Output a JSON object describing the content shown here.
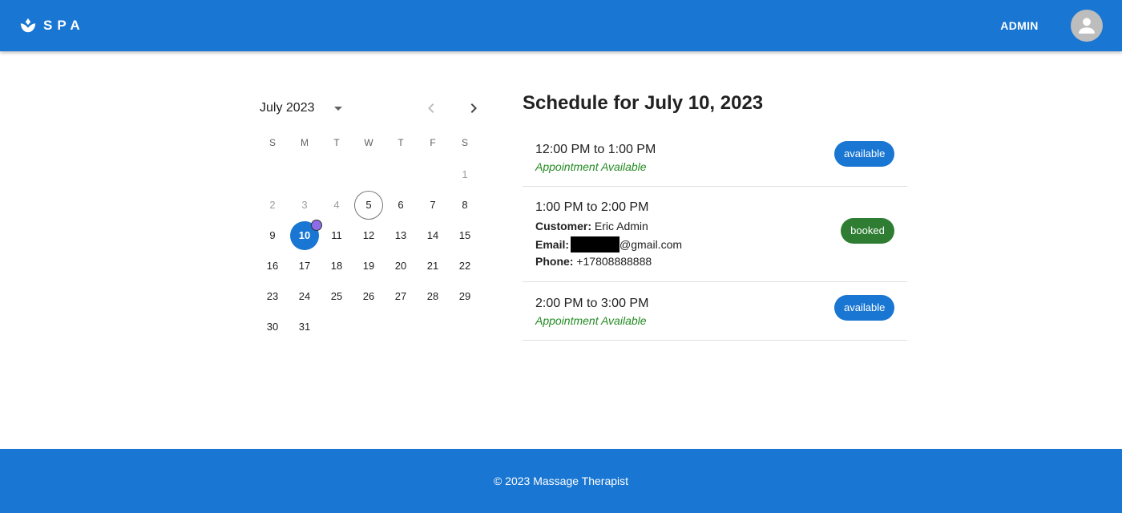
{
  "header": {
    "brand": "SPA",
    "admin_label": "ADMIN",
    "logo_icon": "lotus-icon",
    "avatar_icon": "person-icon"
  },
  "calendar": {
    "month_label": "July 2023",
    "weekdays": [
      "S",
      "M",
      "T",
      "W",
      "T",
      "F",
      "S"
    ],
    "days": [
      {
        "label": "1",
        "muted": true
      },
      {
        "label": "2",
        "muted": true
      },
      {
        "label": "3",
        "muted": true
      },
      {
        "label": "4",
        "muted": true
      },
      {
        "label": "5",
        "today": true
      },
      {
        "label": "6"
      },
      {
        "label": "7"
      },
      {
        "label": "8"
      },
      {
        "label": "9"
      },
      {
        "label": "10",
        "selected": true,
        "has_badge": true
      },
      {
        "label": "11"
      },
      {
        "label": "12"
      },
      {
        "label": "13"
      },
      {
        "label": "14"
      },
      {
        "label": "15"
      },
      {
        "label": "16"
      },
      {
        "label": "17"
      },
      {
        "label": "18"
      },
      {
        "label": "19"
      },
      {
        "label": "20"
      },
      {
        "label": "21"
      },
      {
        "label": "22"
      },
      {
        "label": "23"
      },
      {
        "label": "24"
      },
      {
        "label": "25"
      },
      {
        "label": "26"
      },
      {
        "label": "27"
      },
      {
        "label": "28"
      },
      {
        "label": "29"
      },
      {
        "label": "30"
      },
      {
        "label": "31"
      }
    ],
    "first_weekday_index": 6,
    "colors": {
      "selected": "#1976d2",
      "badge": "#8e6ce8"
    }
  },
  "schedule": {
    "title": "Schedule for July 10, 2023",
    "slots": [
      {
        "time": "12:00 PM to 1:00 PM",
        "status_text": "Appointment Available",
        "chip": "available"
      },
      {
        "time": "1:00 PM to 2:00 PM",
        "customer_label": "Customer:",
        "customer": "Eric Admin",
        "email_label": "Email:",
        "email_suffix": "@gmail.com",
        "phone_label": "Phone:",
        "phone": "+17808888888",
        "chip": "booked"
      },
      {
        "time": "2:00 PM to 3:00 PM",
        "status_text": "Appointment Available",
        "chip": "available"
      }
    ]
  },
  "footer": {
    "text": "© 2023 Massage Therapist"
  },
  "colors": {
    "primary": "#1976d2",
    "booked": "#2e7d32",
    "available_text": "#228b22"
  }
}
